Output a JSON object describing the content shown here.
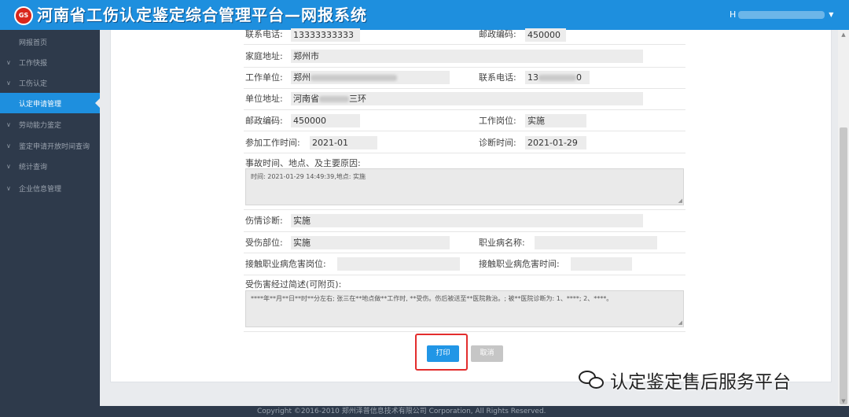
{
  "header": {
    "logo_text": "GS",
    "app_title": "河南省工伤认定鉴定综合管理平台—网报系统",
    "user_initial": "H",
    "icons": {
      "logo": "logo-icon",
      "dropdown": "caret-down-icon"
    }
  },
  "sidebar": {
    "items": [
      {
        "label": "网报首页",
        "chevron": ""
      },
      {
        "label": "工作快报",
        "chevron": "∨"
      },
      {
        "label": "工伤认定",
        "chevron": "∨"
      },
      {
        "label": "认定申请管理",
        "chevron": ""
      },
      {
        "label": "劳动能力鉴定",
        "chevron": "∨"
      },
      {
        "label": "鉴定申请开放时间查询",
        "chevron": "∨"
      },
      {
        "label": "统计查询",
        "chevron": "∨"
      },
      {
        "label": "企业信息管理",
        "chevron": "∨"
      }
    ],
    "active_color": "#1e8fde",
    "background_color": "#2e3a4b"
  },
  "form": {
    "contact_phone_label": "联系电话:",
    "contact_phone_value": "13333333333",
    "postal_code_label": "邮政编码:",
    "postal_code_value": "450000",
    "home_address_label": "家庭地址:",
    "home_address_value": "郑州市",
    "employer_label": "工作单位:",
    "employer_value": "郑州",
    "employer_phone_label": "联系电话:",
    "employer_phone_prefix": "13",
    "employer_phone_suffix": "0",
    "employer_address_label": "单位地址:",
    "employer_address_prefix": "河南省",
    "employer_address_suffix": "三环",
    "employer_postal_label": "邮政编码:",
    "employer_postal_value": "450000",
    "job_position_label": "工作岗位:",
    "job_position_value": "实施",
    "work_start_label": "参加工作时间:",
    "work_start_value": "2021-01",
    "diagnosis_date_label": "诊断时间:",
    "diagnosis_date_value": "2021-01-29",
    "accident_label": "事故时间、地点、及主要原因:",
    "accident_value": "时间: 2021-01-29 14:49:39,地点: 实施",
    "injury_diagnosis_label": "伤情诊断:",
    "injury_diagnosis_value": "实施",
    "injured_part_label": "受伤部位:",
    "injured_part_value": "实施",
    "occupational_disease_label": "职业病名称:",
    "occupational_disease_value": "",
    "hazard_position_label": "接触职业病危害岗位:",
    "hazard_position_value": "",
    "hazard_time_label": "接触职业病危害时间:",
    "hazard_time_value": "",
    "injury_summary_label": "受伤害经过简述(可附页):",
    "injury_summary_value": "****年**月**日**时**分左右; 张三在**地点做**工作时, **受伤。伤后被送至**医院救治。; 被**医院诊断为: 1、****; 2、****。"
  },
  "actions": {
    "print_label": "打印",
    "cancel_label": "取消",
    "primary_color": "#2196e6",
    "highlight_color": "#e32d2d"
  },
  "watermark": {
    "text": "认定鉴定售后服务平台",
    "icon": "wechat-icon"
  },
  "footer": {
    "copyright": "Copyright ©2016-2010 郑州泽普信息技术有限公司 Corporation, All Rights Reserved."
  }
}
